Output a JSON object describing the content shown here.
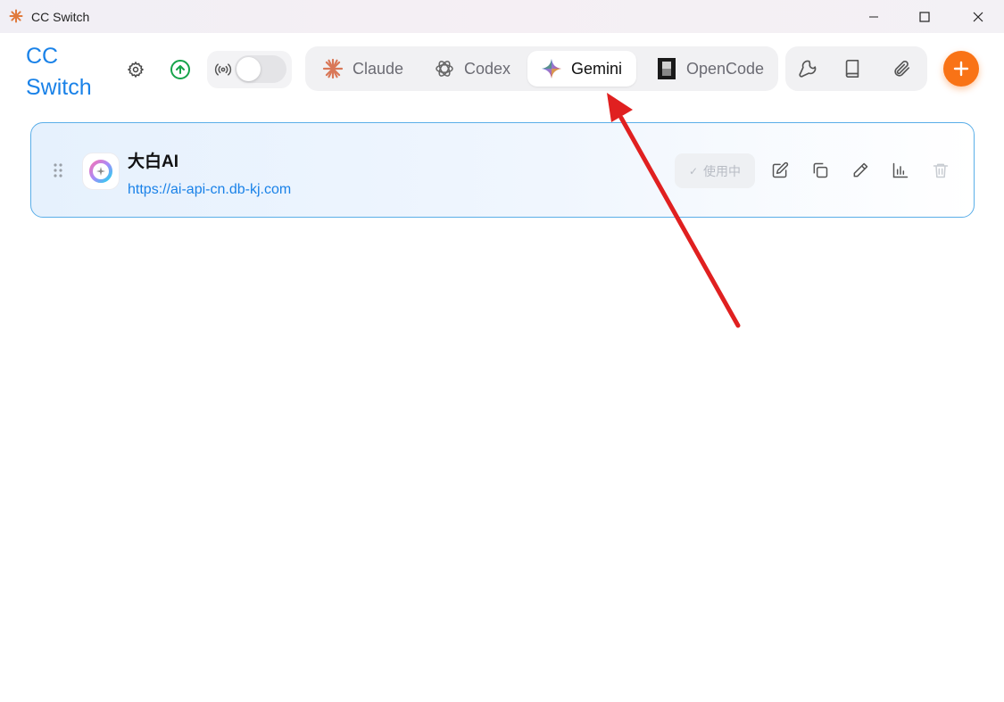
{
  "window": {
    "title": "CC Switch",
    "app_icon": "cc-switch-logo-icon",
    "controls": [
      "minimize-icon",
      "maximize-icon",
      "close-icon"
    ]
  },
  "brand": {
    "line1": "CC",
    "line2": "Switch",
    "color": "#1a82e8"
  },
  "toolbar": {
    "settings_icon": "gear-icon",
    "update_icon": "arrow-up-circle-icon",
    "proxy": {
      "icon": "broadcast-icon",
      "enabled": false
    }
  },
  "tabs": [
    {
      "label": "Claude",
      "icon": "claude-icon",
      "active": false
    },
    {
      "label": "Codex",
      "icon": "openai-icon",
      "active": false
    },
    {
      "label": "Gemini",
      "icon": "gemini-icon",
      "active": true
    },
    {
      "label": "OpenCode",
      "icon": "opencode-icon",
      "active": false
    }
  ],
  "tools": [
    "wrench-icon",
    "book-icon",
    "paperclip-icon"
  ],
  "add_button": {
    "icon": "plus-icon",
    "color": "#f97316"
  },
  "providers": [
    {
      "name": "大白AI",
      "url": "https://ai-api-cn.db-kj.com",
      "status_label": "使用中",
      "actions": [
        "edit-icon",
        "copy-icon",
        "test-icon",
        "stats-icon",
        "trash-icon"
      ]
    }
  ],
  "annotation": {
    "color": "#e02020",
    "points_to": "Gemini"
  }
}
